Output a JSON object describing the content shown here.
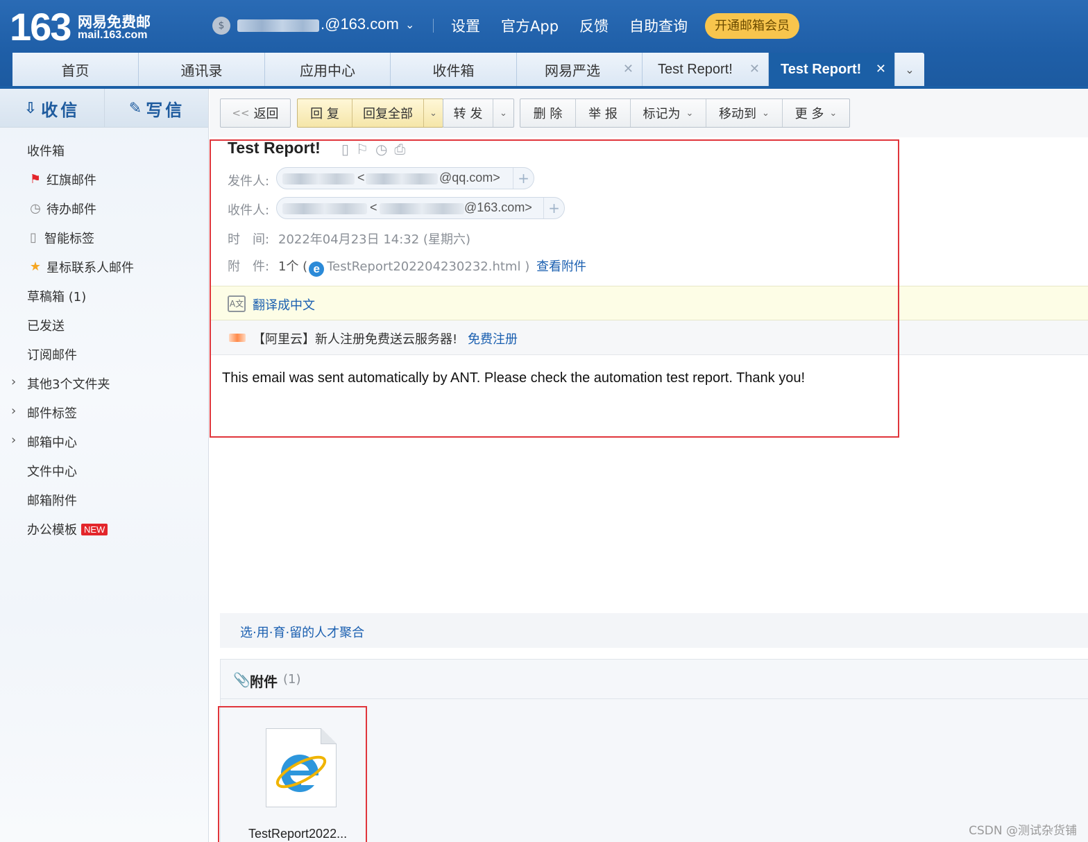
{
  "header": {
    "logo_number": "163",
    "logo_cn": "网易免费邮",
    "logo_url": "mail.163.com",
    "account_icon": "$",
    "account_domain": ".@163.com",
    "links": [
      "设置",
      "官方App",
      "反馈",
      "自助查询"
    ],
    "vip_button": "开通邮箱会员"
  },
  "tabs": [
    {
      "label": "首页",
      "closable": false,
      "active": false
    },
    {
      "label": "通讯录",
      "closable": false,
      "active": false
    },
    {
      "label": "应用中心",
      "closable": false,
      "active": false
    },
    {
      "label": "收件箱",
      "closable": false,
      "active": false
    },
    {
      "label": "网易严选",
      "closable": true,
      "active": false
    },
    {
      "label": "Test Report!",
      "closable": true,
      "active": false
    },
    {
      "label": "Test Report!",
      "closable": true,
      "active": true
    }
  ],
  "sidebar": {
    "receive": "收信",
    "compose": "写信",
    "folders": [
      {
        "label": "收件箱",
        "icon": ""
      },
      {
        "label": "红旗邮件",
        "icon": "red-flag-icon"
      },
      {
        "label": "待办邮件",
        "icon": "clock-icon"
      },
      {
        "label": "智能标签",
        "icon": "bookmark-icon"
      },
      {
        "label": "星标联系人邮件",
        "icon": "star-icon"
      },
      {
        "label": "草稿箱 (1)",
        "icon": ""
      },
      {
        "label": "已发送",
        "icon": ""
      },
      {
        "label": "订阅邮件",
        "icon": ""
      },
      {
        "label": "其他3个文件夹",
        "icon": "",
        "expandable": true
      },
      {
        "label": "邮件标签",
        "icon": "",
        "expandable": true
      },
      {
        "label": "邮箱中心",
        "icon": "",
        "expandable": true
      },
      {
        "label": "文件中心",
        "icon": ""
      },
      {
        "label": "邮箱附件",
        "icon": ""
      },
      {
        "label": "办公模板",
        "icon": "",
        "badge": "NEW"
      }
    ]
  },
  "toolbar": {
    "back": "返回",
    "reply": "回 复",
    "reply_all": "回复全部",
    "forward": "转 发",
    "delete": "删 除",
    "report": "举 报",
    "mark_as": "标记为",
    "move_to": "移动到",
    "more": "更 多"
  },
  "mail": {
    "subject": "Test Report!",
    "from_label": "发件人:",
    "from_lt": "<",
    "from_domain": "@qq.com>",
    "to_label": "收件人:",
    "to_lt": "<",
    "to_domain": "@163.com>",
    "time_label": "时　间:",
    "time_value": "2022年04月23日 14:32 (星期六)",
    "attach_label": "附　件:",
    "attach_count_open": "1个 (",
    "attach_filename": "TestReport202204230232.html",
    "attach_close": ")",
    "view_attachments": "查看附件",
    "translate": "翻译成中文",
    "ad_text": "【阿里云】新人注册免费送云服务器!",
    "ad_link": "免费注册",
    "body": "This email was sent automatically by ANT. Please check the automation test report. Thank you!",
    "signature_link": "选·用·育·留的人才聚合"
  },
  "attachments": {
    "title": "附件",
    "count": "(1)",
    "files": [
      {
        "name": "TestReport2022...",
        "icon": "ie-file-icon"
      }
    ]
  },
  "watermark": "CSDN @测试杂货铺",
  "colors": {
    "header_blue": "#1f5fa8",
    "link_blue": "#1a5fb0",
    "highlight_red": "#e0353b",
    "vip_yellow": "#f8c54d"
  }
}
